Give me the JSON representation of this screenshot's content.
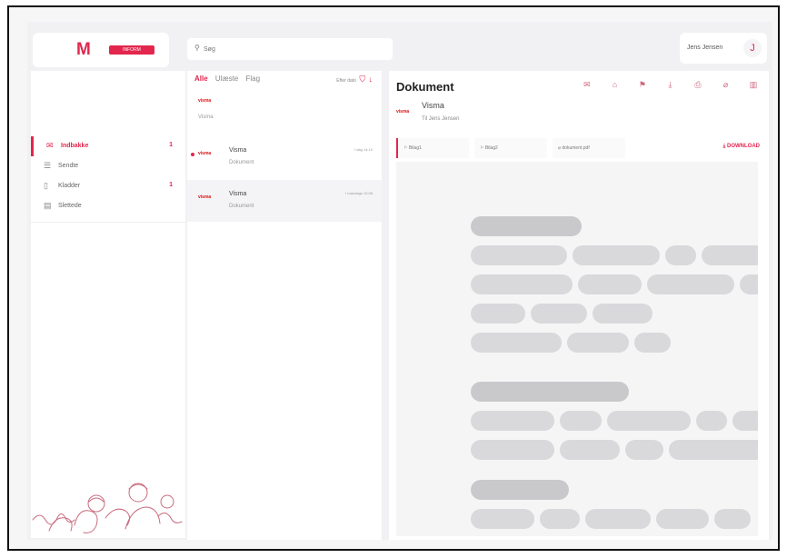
{
  "brand": {
    "badge_text": "INFORM",
    "accent": "#e2264d"
  },
  "search": {
    "placeholder": "Søg"
  },
  "user": {
    "name": "Jens Jensen",
    "initial": "J"
  },
  "sidebar": {
    "items": [
      {
        "label": "Indbakke",
        "count": "1",
        "icon": "inbox-icon"
      },
      {
        "label": "Sendte",
        "count": "",
        "icon": "send-icon"
      },
      {
        "label": "Kladder",
        "count": "1",
        "icon": "draft-icon"
      },
      {
        "label": "Slettede",
        "count": "",
        "icon": "trash-icon"
      }
    ]
  },
  "list": {
    "tabs": [
      "Alle",
      "Ulæste",
      "Flag"
    ],
    "sort_label": "Efter dato",
    "messages": [
      {
        "logo": "visma",
        "sender": "",
        "subject": "Visma",
        "time": ""
      },
      {
        "logo": "visma",
        "sender": "Visma",
        "subject": "Dokument",
        "time": "I dag 14:10",
        "unread": true
      },
      {
        "logo": "visma",
        "sender": "Visma",
        "subject": "Dokument",
        "time": "I mandags 12:08"
      }
    ]
  },
  "document": {
    "title": "Dokument",
    "sender_logo": "visma",
    "sender": "Visma",
    "to": "Til Jens Jensen",
    "attachments": [
      "Bilag1",
      "Bilag2",
      "dokument.pdf"
    ],
    "download_label": "DOWNLOAD",
    "actions": [
      "mail-icon",
      "archive-icon",
      "flag-icon",
      "download-icon",
      "print-icon",
      "attach-icon",
      "delete-icon"
    ]
  }
}
